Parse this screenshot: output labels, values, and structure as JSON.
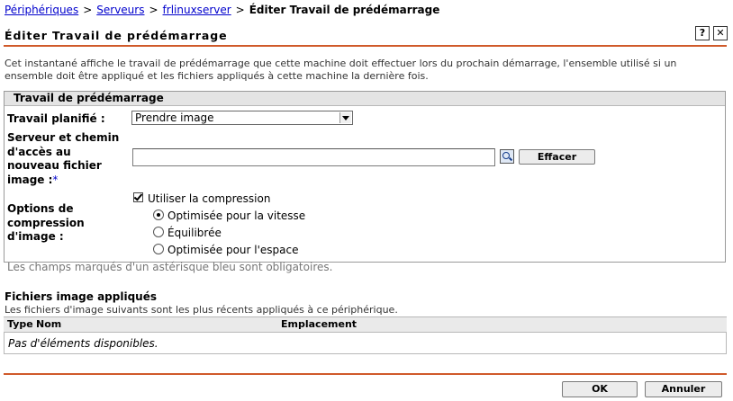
{
  "breadcrumb": {
    "items": [
      "Périphériques",
      "Serveurs",
      "frlinuxserver"
    ],
    "current": "Éditer Travail de prédémarrage",
    "separator": ">"
  },
  "page": {
    "title": "Éditer Travail de prédémarrage",
    "help_label": "?",
    "close_label": "✕",
    "description": "Cet instantané affiche le travail de prédémarrage que cette machine doit effectuer lors du prochain démarrage, l'ensemble utilisé si un ensemble doit être appliqué et les fichiers appliqués à cette machine la dernière fois."
  },
  "form": {
    "section_title": "Travail de prédémarrage",
    "scheduled_label": "Travail planifié :",
    "scheduled_value": "Prendre image",
    "path_label_lines": [
      "Serveur et chemin",
      "d'accès au",
      "nouveau fichier",
      "image :"
    ],
    "required_mark": "*",
    "path_value": "",
    "clear_button": "Effacer",
    "compression_label_lines": [
      "Options de",
      "compression",
      "d'image :"
    ],
    "use_compression": "Utiliser la compression",
    "use_compression_checked": true,
    "options": [
      {
        "label": "Optimisée pour la vitesse",
        "selected": true
      },
      {
        "label": "Équilibrée",
        "selected": false
      },
      {
        "label": "Optimisée pour l'espace",
        "selected": false
      }
    ],
    "required_note": "Les champs marqués d'un astérisque bleu sont obligatoires."
  },
  "applied": {
    "title": "Fichiers image appliqués",
    "subtitle": "Les fichiers d'image suivants sont les plus récents appliqués à ce périphérique.",
    "columns": [
      "Type",
      "Nom",
      "Emplacement"
    ],
    "empty_text": "Pas d'éléments disponibles."
  },
  "footer": {
    "ok_label": "OK",
    "cancel_label": "Annuler"
  },
  "colors": {
    "accent_rule": "#d05a2a",
    "link": "#0000cc",
    "required": "#0000cc"
  }
}
